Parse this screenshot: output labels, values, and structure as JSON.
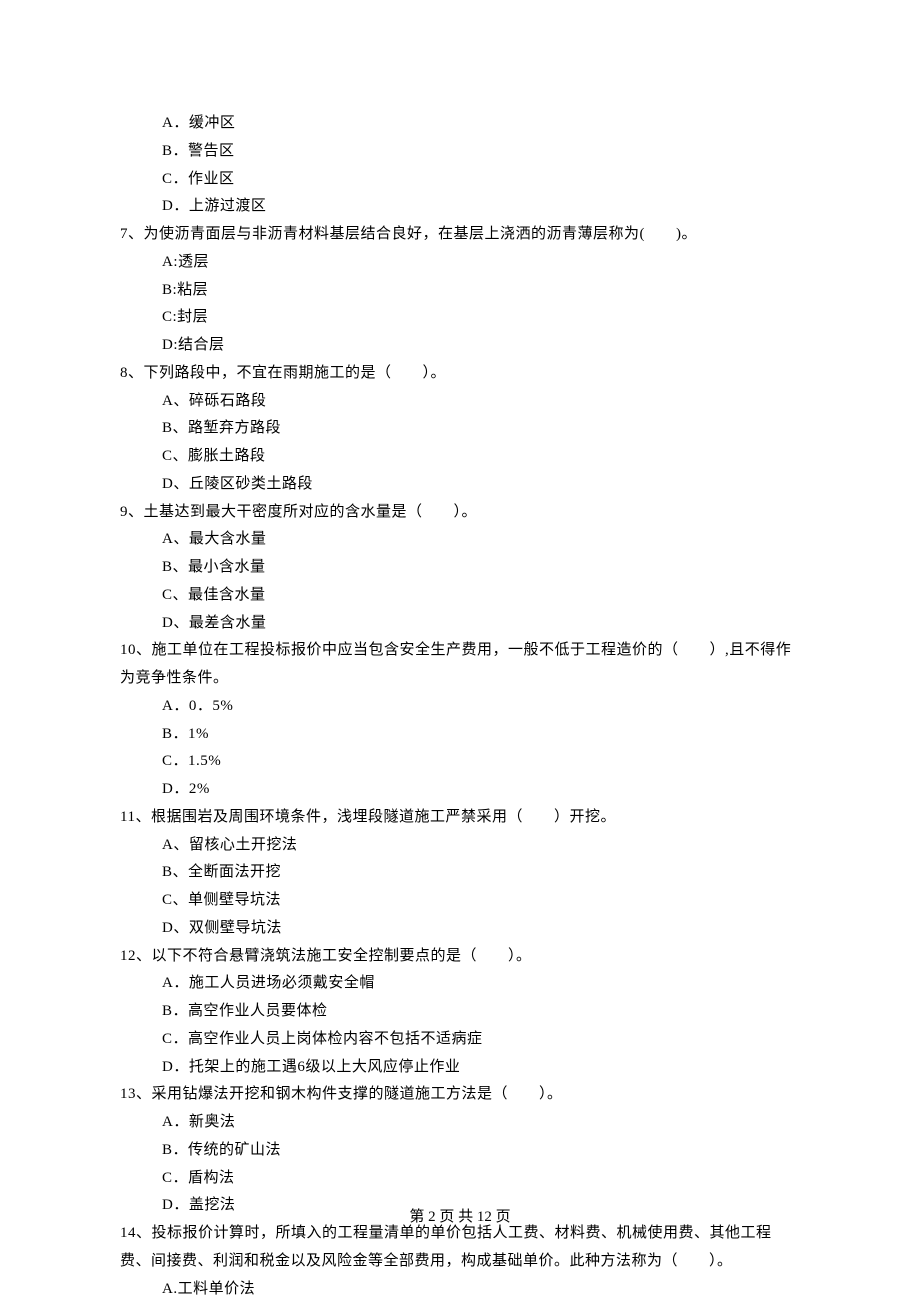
{
  "q6": {
    "options": {
      "a": "A．缓冲区",
      "b": "B．警告区",
      "c": "C．作业区",
      "d": "D．上游过渡区"
    }
  },
  "q7": {
    "stem": "7、为使沥青面层与非沥青材料基层结合良好，在基层上浇洒的沥青薄层称为(　　)。",
    "options": {
      "a": "A:透层",
      "b": "B:粘层",
      "c": "C:封层",
      "d": "D:结合层"
    }
  },
  "q8": {
    "stem": "8、下列路段中，不宜在雨期施工的是（　　）。",
    "options": {
      "a": "A、碎砾石路段",
      "b": "B、路堑弃方路段",
      "c": "C、膨胀土路段",
      "d": "D、丘陵区砂类土路段"
    }
  },
  "q9": {
    "stem": "9、土基达到最大干密度所对应的含水量是（　　）。",
    "options": {
      "a": "A、最大含水量",
      "b": "B、最小含水量",
      "c": "C、最佳含水量",
      "d": "D、最差含水量"
    }
  },
  "q10": {
    "stem": "10、施工单位在工程投标报价中应当包含安全生产费用，一般不低于工程造价的（　　）,且不得作为竞争性条件。",
    "options": {
      "a": "A．0．5%",
      "b": "B．1%",
      "c": "C．1.5%",
      "d": "D．2%"
    }
  },
  "q11": {
    "stem": "11、根据围岩及周围环境条件，浅埋段隧道施工严禁采用（　　）开挖。",
    "options": {
      "a": "A、留核心土开挖法",
      "b": "B、全断面法开挖",
      "c": "C、单侧壁导坑法",
      "d": "D、双侧壁导坑法"
    }
  },
  "q12": {
    "stem": "12、以下不符合悬臂浇筑法施工安全控制要点的是（　　）。",
    "options": {
      "a": "A．施工人员进场必须戴安全帽",
      "b": "B．高空作业人员要体检",
      "c": "C．高空作业人员上岗体检内容不包括不适病症",
      "d": "D．托架上的施工遇6级以上大风应停止作业"
    }
  },
  "q13": {
    "stem": "13、采用钻爆法开挖和钢木构件支撑的隧道施工方法是（　　）。",
    "options": {
      "a": "A．新奥法",
      "b": "B．传统的矿山法",
      "c": "C．盾构法",
      "d": "D．盖挖法"
    }
  },
  "q14": {
    "stem": "14、投标报价计算时，所填入的工程量清单的单价包括人工费、材料费、机械使用费、其他工程费、间接费、利润和税金以及风险金等全部费用，构成基础单价。此种方法称为（　　）。",
    "options": {
      "a": "A.工料单价法"
    }
  },
  "footer": "第 2 页 共 12 页"
}
